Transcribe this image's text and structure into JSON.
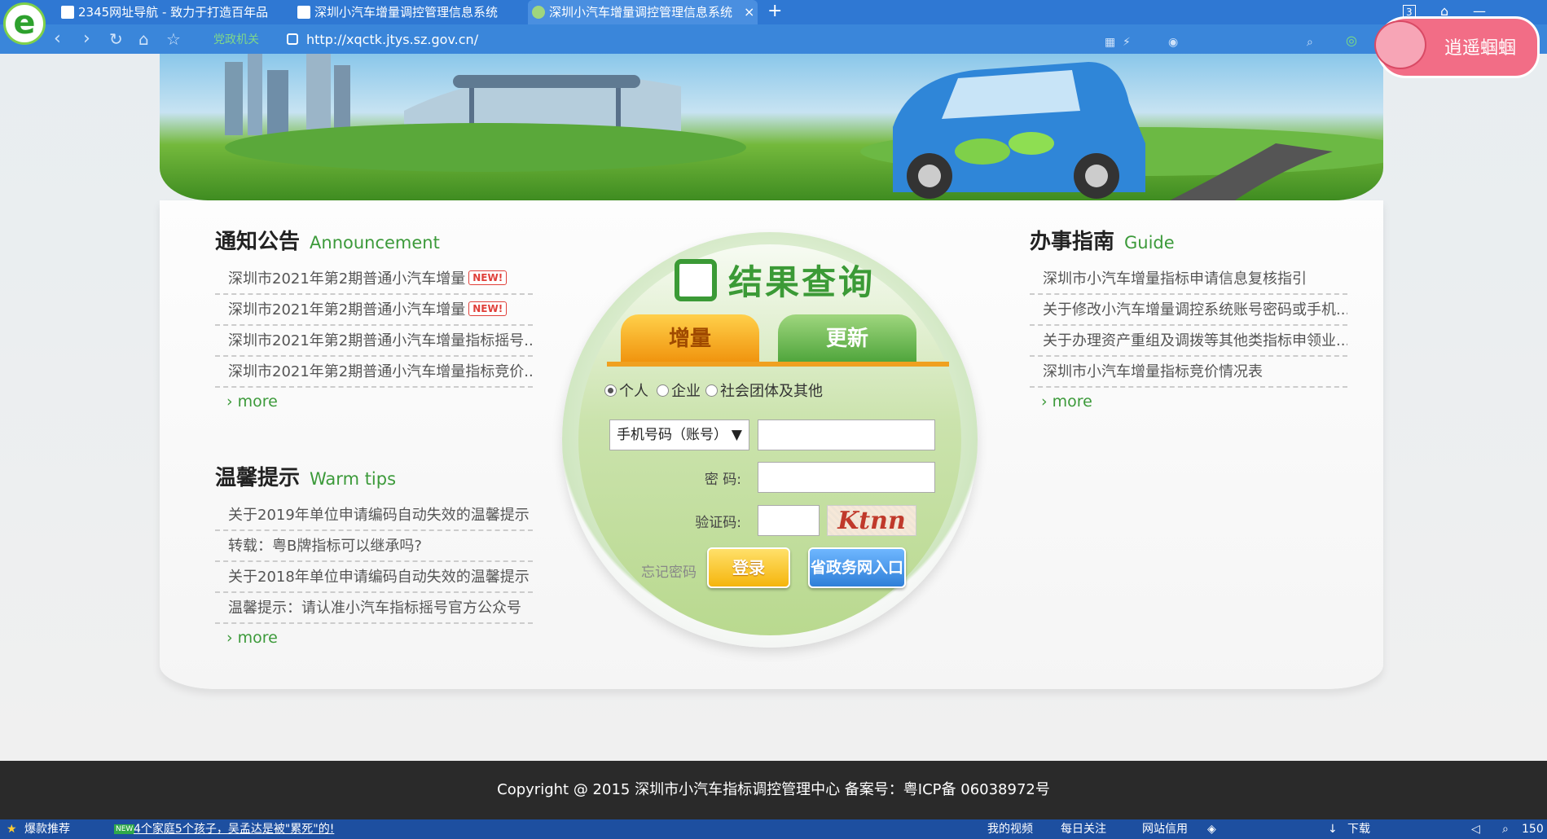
{
  "browser": {
    "tabs": [
      {
        "title": "2345网址导航 - 致力于打造百年品"
      },
      {
        "title": "深圳小汽车增量调控管理信息系统"
      },
      {
        "title": "深圳小汽车增量调控管理信息系统"
      }
    ],
    "tab_close": "×",
    "new_tab": "+",
    "tab_count": "3",
    "gov_label": "党政机关",
    "url": "http://xqctk.jtys.sz.gov.cn/",
    "pet_label": "逍遥蝈蝈"
  },
  "announcement": {
    "title": "通知公告",
    "subtitle": "Announcement",
    "items": [
      {
        "text": "深圳市2021年第2期普通小汽车增量",
        "badge": "NEW!"
      },
      {
        "text": "深圳市2021年第2期普通小汽车增量",
        "badge": "NEW!"
      },
      {
        "text": "深圳市2021年第2期普通小汽车增量指标摇号..",
        "badge": ""
      },
      {
        "text": "深圳市2021年第2期普通小汽车增量指标竞价..",
        "badge": ""
      }
    ],
    "more": "more"
  },
  "tips": {
    "title": "温馨提示",
    "subtitle": "Warm tips",
    "items": [
      "关于2019年单位申请编码自动失效的温馨提示",
      "转载：粤B牌指标可以继承吗?",
      "关于2018年单位申请编码自动失效的温馨提示",
      "温馨提示：请认准小汽车指标摇号官方公众号"
    ],
    "more": "more"
  },
  "guide": {
    "title": "办事指南",
    "subtitle": "Guide",
    "items": [
      "深圳市小汽车增量指标申请信息复核指引",
      "关于修改小汽车增量调控系统账号密码或手机...",
      "关于办理资产重组及调拨等其他类指标申领业...",
      "深圳市小汽车增量指标竞价情况表"
    ],
    "more": "more"
  },
  "query": {
    "title": "结果查询",
    "tab_increment": "增量",
    "tab_renew": "更新",
    "radio_personal": "个人",
    "radio_company": "企业",
    "radio_other": "社会团体及其他",
    "account_type": "手机号码（账号）",
    "account_value": "",
    "password_label": "密 码:",
    "captcha_label": "验证码:",
    "captcha_text": "Ktnn",
    "forget": "忘记密码",
    "login": "登录",
    "gov_portal": "省政务网入口"
  },
  "footer": {
    "text": "Copyright @ 2015 深圳市小汽车指标调控管理中心 备案号：粤ICP备 06038972号"
  },
  "statusbar": {
    "hot": "爆款推荐",
    "news": "4个家庭5个孩子，吴孟达是被\"累死\"的!",
    "video": "我的视频",
    "daily": "每日关注",
    "credit": "网站信用",
    "download": "下载",
    "zoom": "150"
  }
}
